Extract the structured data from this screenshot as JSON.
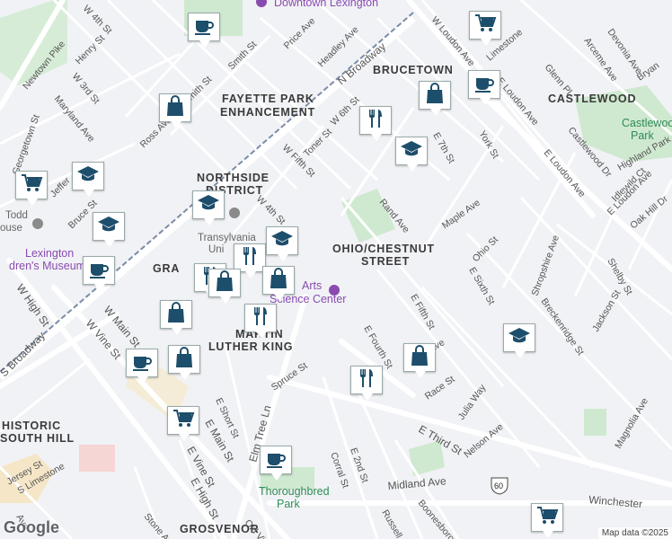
{
  "map": {
    "attribution": "Map data ©2025",
    "logo": "Google",
    "areas": {
      "downtown": "Downtown Lexington",
      "bucetown": "BRUCETOWN",
      "castlewood": "CASTLEWOOD",
      "castlewood_park_1": "Castlewood",
      "castlewood_park_2": "Park",
      "fayette_1": "FAYETTE PARK",
      "fayette_2": "ENHANCEMENT",
      "northside_1": "NORTHSIDE",
      "northside_2": "DISTRICT",
      "ohio_1": "OHIO/CHESTNUT",
      "ohio_2": "STREET",
      "mlk_1": "MARTIN",
      "mlk_2": "LUTHER KING",
      "gra": "GRA",
      "historic_1": "HISTORIC",
      "historic_2": "SOUTH HILL",
      "grosvenor": "GROSVENOR",
      "transylvania_1": "Transylvania",
      "transylvania_2": "Uni",
      "arts_1": "Arts",
      "arts_2": "Science Center",
      "todd_1": "Todd",
      "todd_2": "ouse",
      "lex_children_1": "Lexington",
      "lex_children_2": "dren's Museum",
      "thoroughbred_1": "Thoroughbred",
      "thoroughbred_2": "Park"
    },
    "roads": {
      "w4th": "W 4th St",
      "henry": "Henry St",
      "newtown": "Newtown Pike",
      "w3rd": "W 3rd St",
      "maryland": "Maryland Ave",
      "georgetown": "Georgetown St",
      "jeffer": "Jeffer",
      "bruce": "Bruce St",
      "ross": "Ross Ave",
      "smith1": "mith St",
      "smith2": "Smith St",
      "price": "Price Ave",
      "headley": "Headley Ave",
      "nbroadway": "N Broadway",
      "w6th": "W 6th St",
      "toner": "Toner St",
      "wfifth": "W Fifth St",
      "w4th2": "W 4th St",
      "wloudon": "W Loudon Ave",
      "limestone": "Limestone",
      "glenn": "Glenn Pl",
      "arceme": "Arceme Ave",
      "devonia": "Devonia Ave",
      "bryan": "Bryan",
      "e7th": "E 7th St",
      "york": "York St",
      "eloudon": "E Loudon Ave",
      "eloudon2": "E Loudon Ave",
      "castlewood_dr": "Castlewood Dr",
      "highland": "Highland Park",
      "idlewild": "Idlewild Ct",
      "oakhill": "Oak Hill Dr",
      "maple": "Maple Ave",
      "rand": "Rand Ave",
      "ohio": "Ohio St",
      "esixth": "E Sixth St",
      "shropshire": "Shropshire Ave",
      "shelby": "Shelby St",
      "breckenridge": "Breckenridge St",
      "jackson": "Jackson St",
      "efifth": "E Fifth St",
      "efourth": "E Fourth St",
      "race": "Race St",
      "julia": "Julia Way",
      "magnolia": "Magnolia Ave",
      "nelson": "Nelson Ave",
      "ethird": "E Third St",
      "spruce": "Spruce St",
      "elmtree": "Elm Tree Ln",
      "eshort": "E Short St",
      "emain": "E Main St",
      "evine": "E Vine St",
      "ehigh": "E High St",
      "e2nd": "E 2nd St",
      "corral": "Corral St",
      "midland": "Midland Ave",
      "winchester": "Winchester",
      "russell": "Russell",
      "boonesboro": "Boonesboro",
      "stone": "Stone Ave",
      "oldvine": "Old Vi",
      "whigh": "W High St",
      "sbroadway": "S Broadway",
      "wvine": "W Vine St",
      "wmain": "W Main St",
      "jersey": "Jersey St",
      "slimestone": "S Limestone",
      "ave": "Ave",
      "ave2": "Ave",
      "route60": "60"
    },
    "markers": [
      {
        "icon": "coffee-icon"
      },
      {
        "icon": "shopping-cart-icon"
      },
      {
        "icon": "coffee-icon"
      },
      {
        "icon": "shopping-bag-icon"
      },
      {
        "icon": "shopping-bag-icon"
      },
      {
        "icon": "restaurant-icon"
      },
      {
        "icon": "school-icon"
      },
      {
        "icon": "shopping-cart-icon"
      },
      {
        "icon": "school-icon"
      },
      {
        "icon": "school-icon"
      },
      {
        "icon": "school-icon"
      },
      {
        "icon": "coffee-icon"
      },
      {
        "icon": "restaurant-icon"
      },
      {
        "icon": "shopping-bag-icon"
      },
      {
        "icon": "school-icon"
      },
      {
        "icon": "restaurant-icon"
      },
      {
        "icon": "shopping-bag-icon"
      },
      {
        "icon": "coffee-icon"
      },
      {
        "icon": "shopping-bag-icon"
      },
      {
        "icon": "restaurant-icon"
      },
      {
        "icon": "shopping-bag-icon"
      },
      {
        "icon": "school-icon"
      },
      {
        "icon": "shopping-cart-icon"
      },
      {
        "icon": "coffee-icon"
      },
      {
        "icon": "shopping-cart-icon"
      },
      {
        "icon": "shopping-bag-icon"
      },
      {
        "icon": "restaurant-icon"
      }
    ],
    "colors": {
      "marker_blue": "#1d4e6b",
      "park_green": "#c8e6c9",
      "road_white": "#ffffff",
      "railway": "#7b8ca8",
      "purple_poi": "#8a4bb1"
    }
  }
}
